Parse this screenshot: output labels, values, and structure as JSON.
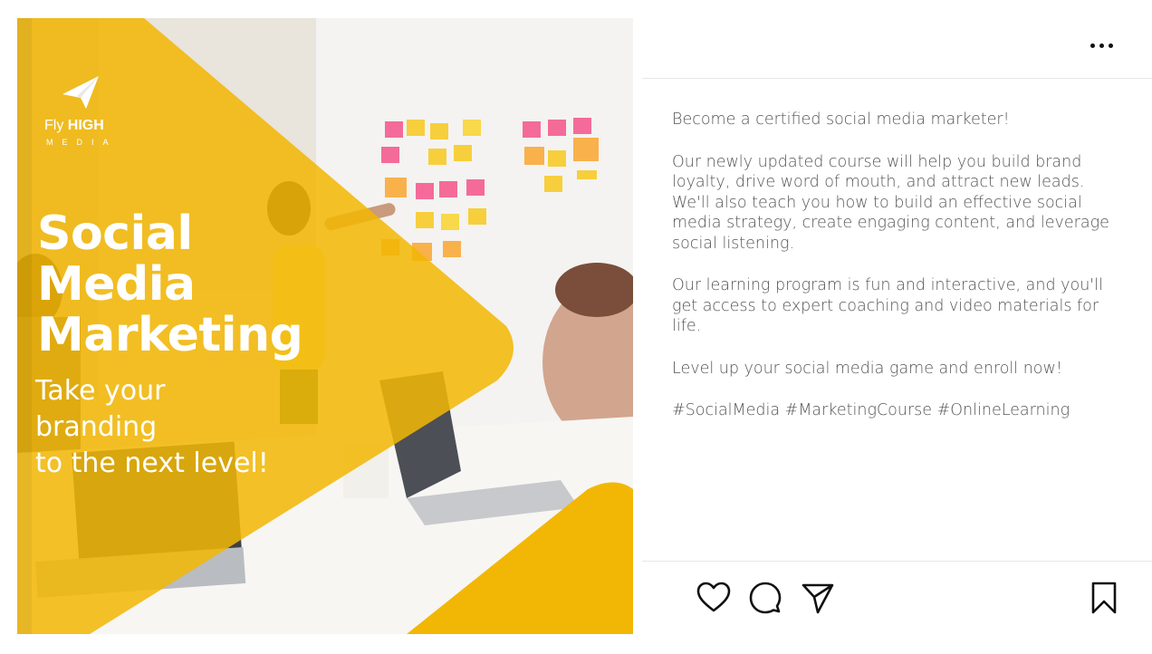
{
  "post": {
    "brand": {
      "name_regular": "Fly ",
      "name_bold": "HIGH",
      "subtitle": "MEDIA",
      "logo_icon": "paper-plane-icon"
    },
    "headline": [
      "Social",
      "Media",
      "Marketing"
    ],
    "tagline": [
      "Take your",
      "branding",
      "to the next level!"
    ],
    "colors": {
      "accent_yellow": "#F2B705",
      "text_white": "#FFFFFF"
    }
  },
  "caption": {
    "more_icon": "more-options-icon",
    "paragraphs": [
      "Become a certified social media marketer!",
      "Our newly updated course will help you build brand loyalty, drive word of mouth, and attract new leads. We'll also teach you how to build an effective social media strategy, create engaging content, and leverage social listening.",
      "Our learning program is fun and interactive, and you'll get access to expert coaching and video materials for life.",
      "Level up your social media game and enroll now!",
      "#SocialMedia #MarketingCourse #OnlineLearning"
    ]
  },
  "actions": {
    "like_icon": "heart-icon",
    "comment_icon": "comment-icon",
    "share_icon": "send-icon",
    "save_icon": "bookmark-icon"
  }
}
